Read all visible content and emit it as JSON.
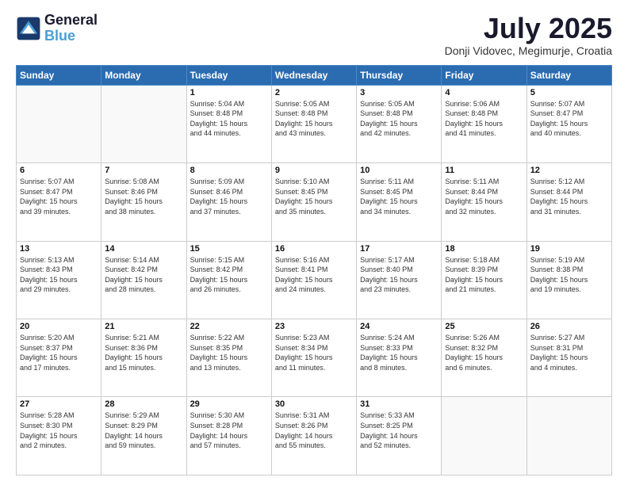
{
  "header": {
    "logo_line1": "General",
    "logo_line2": "Blue",
    "month": "July 2025",
    "location": "Donji Vidovec, Megimurje, Croatia"
  },
  "weekdays": [
    "Sunday",
    "Monday",
    "Tuesday",
    "Wednesday",
    "Thursday",
    "Friday",
    "Saturday"
  ],
  "weeks": [
    [
      {
        "day": "",
        "info": ""
      },
      {
        "day": "",
        "info": ""
      },
      {
        "day": "1",
        "info": "Sunrise: 5:04 AM\nSunset: 8:48 PM\nDaylight: 15 hours\nand 44 minutes."
      },
      {
        "day": "2",
        "info": "Sunrise: 5:05 AM\nSunset: 8:48 PM\nDaylight: 15 hours\nand 43 minutes."
      },
      {
        "day": "3",
        "info": "Sunrise: 5:05 AM\nSunset: 8:48 PM\nDaylight: 15 hours\nand 42 minutes."
      },
      {
        "day": "4",
        "info": "Sunrise: 5:06 AM\nSunset: 8:48 PM\nDaylight: 15 hours\nand 41 minutes."
      },
      {
        "day": "5",
        "info": "Sunrise: 5:07 AM\nSunset: 8:47 PM\nDaylight: 15 hours\nand 40 minutes."
      }
    ],
    [
      {
        "day": "6",
        "info": "Sunrise: 5:07 AM\nSunset: 8:47 PM\nDaylight: 15 hours\nand 39 minutes."
      },
      {
        "day": "7",
        "info": "Sunrise: 5:08 AM\nSunset: 8:46 PM\nDaylight: 15 hours\nand 38 minutes."
      },
      {
        "day": "8",
        "info": "Sunrise: 5:09 AM\nSunset: 8:46 PM\nDaylight: 15 hours\nand 37 minutes."
      },
      {
        "day": "9",
        "info": "Sunrise: 5:10 AM\nSunset: 8:45 PM\nDaylight: 15 hours\nand 35 minutes."
      },
      {
        "day": "10",
        "info": "Sunrise: 5:11 AM\nSunset: 8:45 PM\nDaylight: 15 hours\nand 34 minutes."
      },
      {
        "day": "11",
        "info": "Sunrise: 5:11 AM\nSunset: 8:44 PM\nDaylight: 15 hours\nand 32 minutes."
      },
      {
        "day": "12",
        "info": "Sunrise: 5:12 AM\nSunset: 8:44 PM\nDaylight: 15 hours\nand 31 minutes."
      }
    ],
    [
      {
        "day": "13",
        "info": "Sunrise: 5:13 AM\nSunset: 8:43 PM\nDaylight: 15 hours\nand 29 minutes."
      },
      {
        "day": "14",
        "info": "Sunrise: 5:14 AM\nSunset: 8:42 PM\nDaylight: 15 hours\nand 28 minutes."
      },
      {
        "day": "15",
        "info": "Sunrise: 5:15 AM\nSunset: 8:42 PM\nDaylight: 15 hours\nand 26 minutes."
      },
      {
        "day": "16",
        "info": "Sunrise: 5:16 AM\nSunset: 8:41 PM\nDaylight: 15 hours\nand 24 minutes."
      },
      {
        "day": "17",
        "info": "Sunrise: 5:17 AM\nSunset: 8:40 PM\nDaylight: 15 hours\nand 23 minutes."
      },
      {
        "day": "18",
        "info": "Sunrise: 5:18 AM\nSunset: 8:39 PM\nDaylight: 15 hours\nand 21 minutes."
      },
      {
        "day": "19",
        "info": "Sunrise: 5:19 AM\nSunset: 8:38 PM\nDaylight: 15 hours\nand 19 minutes."
      }
    ],
    [
      {
        "day": "20",
        "info": "Sunrise: 5:20 AM\nSunset: 8:37 PM\nDaylight: 15 hours\nand 17 minutes."
      },
      {
        "day": "21",
        "info": "Sunrise: 5:21 AM\nSunset: 8:36 PM\nDaylight: 15 hours\nand 15 minutes."
      },
      {
        "day": "22",
        "info": "Sunrise: 5:22 AM\nSunset: 8:35 PM\nDaylight: 15 hours\nand 13 minutes."
      },
      {
        "day": "23",
        "info": "Sunrise: 5:23 AM\nSunset: 8:34 PM\nDaylight: 15 hours\nand 11 minutes."
      },
      {
        "day": "24",
        "info": "Sunrise: 5:24 AM\nSunset: 8:33 PM\nDaylight: 15 hours\nand 8 minutes."
      },
      {
        "day": "25",
        "info": "Sunrise: 5:26 AM\nSunset: 8:32 PM\nDaylight: 15 hours\nand 6 minutes."
      },
      {
        "day": "26",
        "info": "Sunrise: 5:27 AM\nSunset: 8:31 PM\nDaylight: 15 hours\nand 4 minutes."
      }
    ],
    [
      {
        "day": "27",
        "info": "Sunrise: 5:28 AM\nSunset: 8:30 PM\nDaylight: 15 hours\nand 2 minutes."
      },
      {
        "day": "28",
        "info": "Sunrise: 5:29 AM\nSunset: 8:29 PM\nDaylight: 14 hours\nand 59 minutes."
      },
      {
        "day": "29",
        "info": "Sunrise: 5:30 AM\nSunset: 8:28 PM\nDaylight: 14 hours\nand 57 minutes."
      },
      {
        "day": "30",
        "info": "Sunrise: 5:31 AM\nSunset: 8:26 PM\nDaylight: 14 hours\nand 55 minutes."
      },
      {
        "day": "31",
        "info": "Sunrise: 5:33 AM\nSunset: 8:25 PM\nDaylight: 14 hours\nand 52 minutes."
      },
      {
        "day": "",
        "info": ""
      },
      {
        "day": "",
        "info": ""
      }
    ]
  ]
}
